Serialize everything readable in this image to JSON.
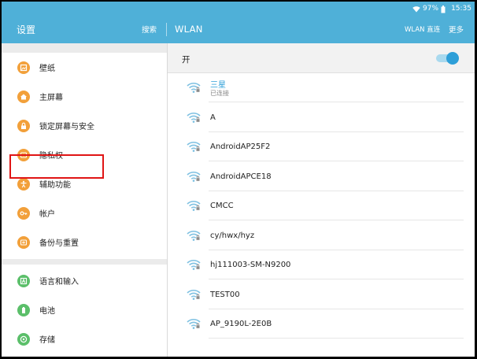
{
  "status_bar": {
    "battery": "97%",
    "time": "15:35"
  },
  "left_header": {
    "title": "设置",
    "search_label": "搜索"
  },
  "right_header": {
    "title": "WLAN",
    "wlan_direct_label": "WLAN 直连",
    "more_label": "更多"
  },
  "settings_menu": {
    "group1": [
      {
        "label": "壁纸",
        "icon": "wallpaper-icon"
      },
      {
        "label": "主屏幕",
        "icon": "home-icon"
      },
      {
        "label": "锁定屏幕与安全",
        "icon": "lock-icon"
      },
      {
        "label": "隐私权",
        "icon": "privacy-icon"
      },
      {
        "label": "辅助功能",
        "icon": "accessibility-icon"
      },
      {
        "label": "帐户",
        "icon": "key-icon"
      },
      {
        "label": "备份与重置",
        "icon": "backup-icon"
      }
    ],
    "group2": [
      {
        "label": "语言和输入",
        "icon": "language-icon"
      },
      {
        "label": "电池",
        "icon": "battery-icon"
      },
      {
        "label": "存储",
        "icon": "storage-icon"
      }
    ],
    "highlighted_item": "锁定屏幕与安全"
  },
  "wlan": {
    "toggle_label": "开",
    "toggle_on": true,
    "networks": [
      {
        "name": "三星",
        "status": "已连接"
      },
      {
        "name": "A"
      },
      {
        "name": "AndroidAP25F2"
      },
      {
        "name": "AndroidAPCE18"
      },
      {
        "name": "CMCC"
      },
      {
        "name": "cy/hwx/hyz"
      },
      {
        "name": "hj111003-SM-N9200"
      },
      {
        "name": "TEST00"
      },
      {
        "name": "AP_9190L-2E0B"
      }
    ]
  },
  "colors": {
    "action_bar": "#4fb0d8",
    "accent": "#2e9fd8",
    "icon_orange": "#f2a03a",
    "icon_green": "#5bbf6a",
    "highlight_border": "#e01515"
  }
}
